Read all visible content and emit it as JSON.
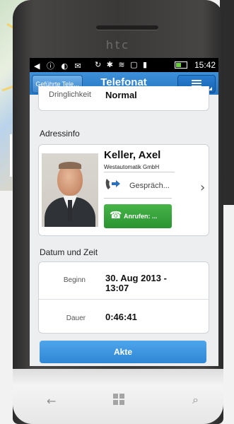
{
  "device": {
    "brand": "htc"
  },
  "statusbar": {
    "icons_left": "◀ ⓘ ◐ ✉",
    "icons_right": "↻ ✱ ≋ ▢ ▮",
    "time": "15:42"
  },
  "appbar": {
    "back_label": "Geführte Tele...",
    "title": "Telefonat",
    "menu_icon": "menu-icon"
  },
  "priority": {
    "label": "Dringlichkeit",
    "value": "Normal"
  },
  "address": {
    "section_title": "Adressinfo",
    "name": "Keller, Axel",
    "company": "Westautomatik GmbH",
    "conversation_label": "Gespräch...",
    "call_button_label": "Anrufen: ..."
  },
  "date": {
    "section_title": "Datum und Zeit",
    "begin_label": "Beginn",
    "begin_value": "30. Aug 2013 - 13:07",
    "duration_label": "Dauer",
    "duration_value": "0:46:41"
  },
  "footer": {
    "akte_label": "Akte"
  },
  "colors": {
    "appbar": "#2577c5",
    "call_button": "#2a9430",
    "akte_button": "#2f87d6"
  }
}
